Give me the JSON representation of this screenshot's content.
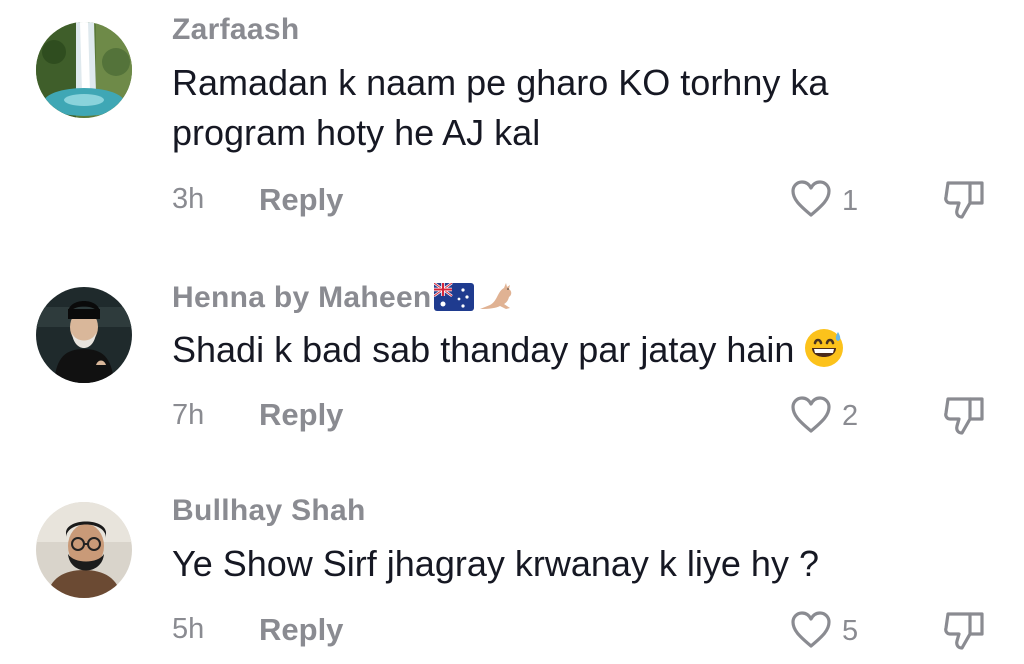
{
  "comments": [
    {
      "username": "Zarfaash",
      "text": "Ramadan k naam pe gharo KO torhny ka program hoty he AJ kal",
      "time": "3h",
      "reply_label": "Reply",
      "likes": "1",
      "avatar": "waterfall-photo"
    },
    {
      "username": "Henna by Maheen",
      "username_suffix_icons": [
        "australia-flag-icon",
        "kangaroo-icon"
      ],
      "text": "Shadi k bad sab thanday par jatay hain",
      "text_emoji": "grinning-sweat-emoji",
      "time": "7h",
      "reply_label": "Reply",
      "likes": "2",
      "avatar": "elderly-man-photo"
    },
    {
      "username": "Bullhay Shah",
      "text": "Ye Show Sirf jhagray krwanay k liye hy ?",
      "time": "5h",
      "reply_label": "Reply",
      "likes": "5",
      "avatar": "man-with-glasses-photo"
    }
  ],
  "colors": {
    "text": "#161823",
    "secondary": "#8a8b91",
    "icon": "#8a8b91"
  }
}
